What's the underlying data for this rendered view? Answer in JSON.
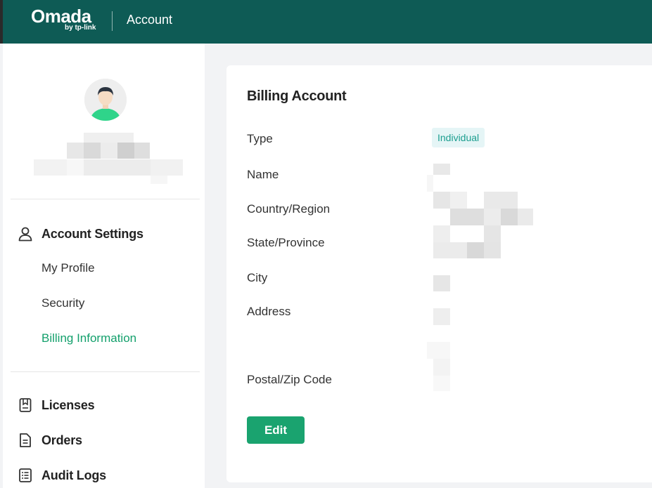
{
  "header": {
    "logo_text": "Omada",
    "logo_sub": "by tp-link",
    "title": "Account"
  },
  "sidebar": {
    "groups": [
      {
        "label": "Account Settings",
        "icon": "user-icon"
      },
      {
        "label": "Licenses",
        "icon": "license-icon"
      },
      {
        "label": "Orders",
        "icon": "document-icon"
      },
      {
        "label": "Audit Logs",
        "icon": "list-icon"
      }
    ],
    "account_items": [
      {
        "label": "My Profile",
        "active": false
      },
      {
        "label": "Security",
        "active": false
      },
      {
        "label": "Billing Information",
        "active": true
      }
    ]
  },
  "billing": {
    "title": "Billing Account",
    "type_label": "Type",
    "type_value": "Individual",
    "name_label": "Name",
    "country_label": "Country/Region",
    "state_label": "State/Province",
    "city_label": "City",
    "address_label": "Address",
    "postal_label": "Postal/Zip Code",
    "edit_label": "Edit"
  },
  "colors": {
    "header_bg": "#0e5b55",
    "accent": "#13a06c",
    "button": "#1aa36f",
    "badge_bg": "#e5f5f6",
    "badge_text": "#1b9e8f"
  }
}
